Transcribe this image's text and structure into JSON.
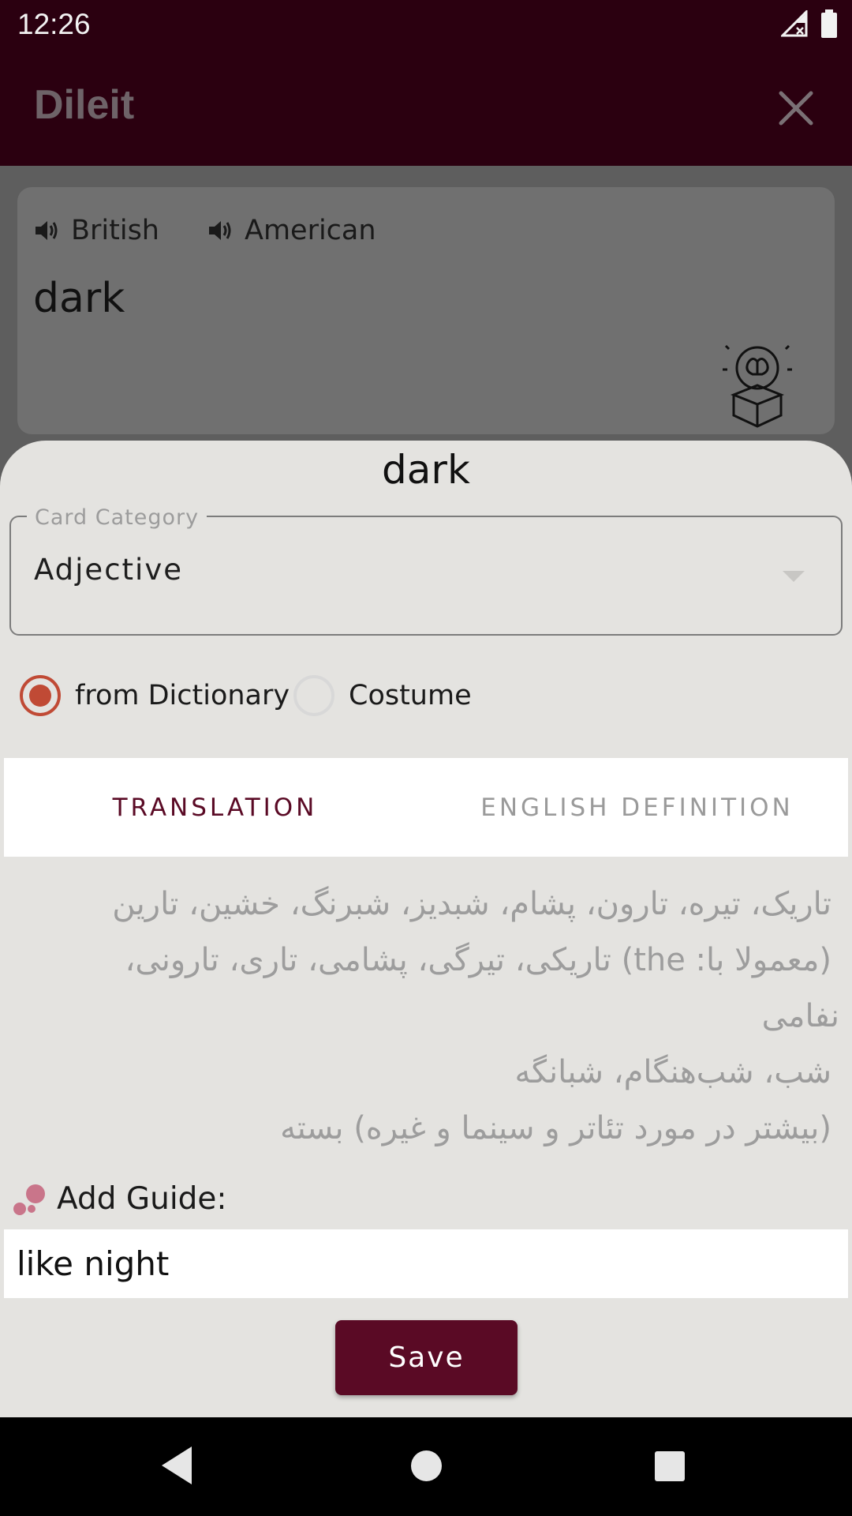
{
  "status_bar": {
    "time": "12:26"
  },
  "app_bar": {
    "title": "Dileit"
  },
  "word_card": {
    "pronunciations": [
      "British",
      "American"
    ],
    "word": "dark"
  },
  "sheet": {
    "title": "dark",
    "category": {
      "label": "Card Category",
      "value": "Adjective"
    },
    "source_options": [
      {
        "label": "from Dictionary",
        "selected": true
      },
      {
        "label": "Costume",
        "selected": false
      }
    ],
    "tabs": [
      {
        "label": "TRANSLATION",
        "active": true
      },
      {
        "label": "ENGLISH DEFINITION",
        "active": false
      }
    ],
    "translation_lines": [
      "تاریک، تیره، تارون، پشام، شبدیز، شبرنگ، خشین، تارین",
      "(معمولا با: the) تاریکی، تیرگی، پشامی، تاری، تارونی،",
      "نفامی",
      "شب، شب‌هنگام، شبانگه",
      "(بیشتر در مورد تئاتر و سینما و غیره) بسته"
    ],
    "guide": {
      "label": "Add Guide:",
      "value": "like night"
    },
    "save_label": "Save"
  },
  "colors": {
    "primary": "#5a0a25",
    "accent": "#c04a35",
    "status_bar": "#2b0010"
  },
  "icons": {
    "speaker": "speaker-icon",
    "close": "close-icon",
    "brain_box": "brain-box-icon",
    "guide": "bubbles-icon"
  }
}
